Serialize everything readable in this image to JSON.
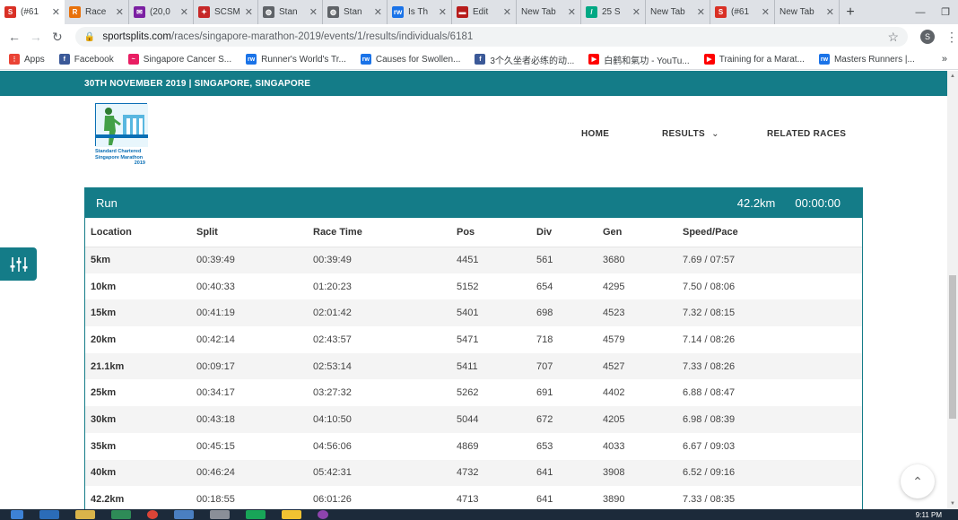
{
  "browser": {
    "tabs": [
      {
        "title": "(#61",
        "icon_color": "#d93025",
        "icon_glyph": "S"
      },
      {
        "title": "Race",
        "icon_color": "#e8710a",
        "icon_glyph": "R"
      },
      {
        "title": "(20,0",
        "icon_color": "#7b1fa2",
        "icon_glyph": "✉"
      },
      {
        "title": "SCSM",
        "icon_color": "#c62828",
        "icon_glyph": "✦"
      },
      {
        "title": "Stan",
        "icon_color": "#5f6368",
        "icon_glyph": "◍"
      },
      {
        "title": "Stan",
        "icon_color": "#5f6368",
        "icon_glyph": "◍"
      },
      {
        "title": "Is Th",
        "icon_color": "#1a73e8",
        "icon_glyph": "rw"
      },
      {
        "title": "Edit",
        "icon_color": "#b71c1c",
        "icon_glyph": "▬"
      },
      {
        "title": "New Tab",
        "icon_color": "",
        "icon_glyph": ""
      },
      {
        "title": "25 S",
        "icon_color": "#00a884",
        "icon_glyph": "/"
      },
      {
        "title": "New Tab",
        "icon_color": "",
        "icon_glyph": ""
      },
      {
        "title": "(#61",
        "icon_color": "#d93025",
        "icon_glyph": "S"
      },
      {
        "title": "New Tab",
        "icon_color": "",
        "icon_glyph": ""
      }
    ],
    "url_host": "sportsplits.com",
    "url_path": "/races/singapore-marathon-2019/events/1/results/individuals/6181",
    "profile_initial": "S",
    "bookmarks": [
      {
        "label": "Apps",
        "icon_color": "#ea4335",
        "icon_glyph": "⋮"
      },
      {
        "label": "Facebook",
        "icon_color": "#3b5998",
        "icon_glyph": "f"
      },
      {
        "label": "Singapore Cancer S...",
        "icon_color": "#e91e63",
        "icon_glyph": "~"
      },
      {
        "label": "Runner's World's Tr...",
        "icon_color": "#1a73e8",
        "icon_glyph": "rw"
      },
      {
        "label": "Causes for Swollen...",
        "icon_color": "#1a73e8",
        "icon_glyph": "rw"
      },
      {
        "label": "3个久坐者必练的动...",
        "icon_color": "#3b5998",
        "icon_glyph": "f"
      },
      {
        "label": "白鹤和氣功 - YouTu...",
        "icon_color": "#ff0000",
        "icon_glyph": "▶"
      },
      {
        "label": "Training for a Marat...",
        "icon_color": "#ff0000",
        "icon_glyph": "▶"
      },
      {
        "label": "Masters Runners |...",
        "icon_color": "#1a73e8",
        "icon_glyph": "rw"
      }
    ],
    "bookmarks_more": "»"
  },
  "site": {
    "event_line": "30TH NOVEMBER 2019 | SINGAPORE, SINGAPORE",
    "logo_text_1": "Standard Chartered",
    "logo_text_2": "Singapore Marathon",
    "logo_text_3": "2019",
    "nav": {
      "home": "HOME",
      "results": "RESULTS",
      "related": "RELATED RACES"
    }
  },
  "results": {
    "leg": "Run",
    "distance": "42.2km",
    "time": "00:00:00",
    "columns": [
      "Location",
      "Split",
      "Race Time",
      "Pos",
      "Div",
      "Gen",
      "Speed/Pace"
    ],
    "rows": [
      [
        "5km",
        "00:39:49",
        "00:39:49",
        "4451",
        "561",
        "3680",
        "7.69 / 07:57"
      ],
      [
        "10km",
        "00:40:33",
        "01:20:23",
        "5152",
        "654",
        "4295",
        "7.50 / 08:06"
      ],
      [
        "15km",
        "00:41:19",
        "02:01:42",
        "5401",
        "698",
        "4523",
        "7.32 / 08:15"
      ],
      [
        "20km",
        "00:42:14",
        "02:43:57",
        "5471",
        "718",
        "4579",
        "7.14 / 08:26"
      ],
      [
        "21.1km",
        "00:09:17",
        "02:53:14",
        "5411",
        "707",
        "4527",
        "7.33 / 08:26"
      ],
      [
        "25km",
        "00:34:17",
        "03:27:32",
        "5262",
        "691",
        "4402",
        "6.88 / 08:47"
      ],
      [
        "30km",
        "00:43:18",
        "04:10:50",
        "5044",
        "672",
        "4205",
        "6.98 / 08:39"
      ],
      [
        "35km",
        "00:45:15",
        "04:56:06",
        "4869",
        "653",
        "4033",
        "6.67 / 09:03"
      ],
      [
        "40km",
        "00:46:24",
        "05:42:31",
        "4732",
        "641",
        "3908",
        "6.52 / 09:16"
      ],
      [
        "42.2km",
        "00:18:55",
        "06:01:26",
        "4713",
        "641",
        "3890",
        "7.33 / 08:35"
      ]
    ]
  },
  "taskbar": {
    "clock": "9:11 PM"
  },
  "colors": {
    "accent": "#147c88"
  }
}
